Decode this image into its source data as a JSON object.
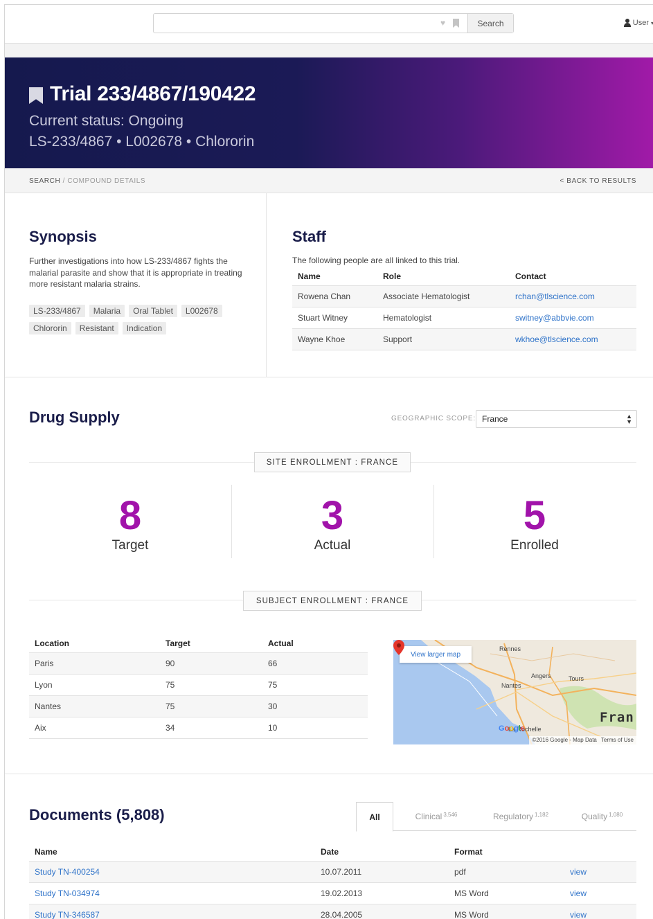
{
  "header": {
    "search": {
      "value": "",
      "placeholder": "",
      "button_label": "Search"
    },
    "user_label": "User"
  },
  "hero": {
    "title": "Trial 233/4867/190422",
    "status": "Current status: Ongoing",
    "ids": "LS-233/4867 • L002678 • Chlororin"
  },
  "breadcrumb": {
    "root": "SEARCH",
    "separator": " / ",
    "current": "COMPOUND DETAILS",
    "back": "< BACK TO RESULTS"
  },
  "synopsis": {
    "heading": "Synopsis",
    "text": "Further investigations into how LS-233/4867 fights the malarial parasite and show that it is appropriate in treating more resistant malaria strains.",
    "tags": [
      "LS-233/4867",
      "Malaria",
      "Oral Tablet",
      "L002678",
      "Chlororin",
      "Resistant",
      "Indication"
    ]
  },
  "staff": {
    "heading": "Staff",
    "intro": "The following people are all linked to this trial.",
    "columns": [
      "Name",
      "Role",
      "Contact"
    ],
    "rows": [
      [
        "Rowena Chan",
        "Associate Hematologist",
        "rchan@tlscience.com"
      ],
      [
        "Stuart Witney",
        "Hematologist",
        "switney@abbvie.com"
      ],
      [
        "Wayne Khoe",
        "Support",
        "wkhoe@tlscience.com"
      ]
    ]
  },
  "drug_supply": {
    "heading": "Drug Supply",
    "scope_label": "GEOGRAPHIC SCOPE:",
    "scope_value": "France",
    "site_enrollment_label": "SITE ENROLLMENT : FRANCE",
    "stats": [
      {
        "value": "8",
        "label": "Target"
      },
      {
        "value": "3",
        "label": "Actual"
      },
      {
        "value": "5",
        "label": "Enrolled"
      }
    ],
    "subject_enrollment_label": "SUBJECT ENROLLMENT : FRANCE",
    "table": {
      "columns": [
        "Location",
        "Target",
        "Actual"
      ],
      "rows": [
        [
          "Paris",
          "90",
          "66"
        ],
        [
          "Lyon",
          "75",
          "75"
        ],
        [
          "Nantes",
          "75",
          "30"
        ],
        [
          "Aix",
          "34",
          "10"
        ]
      ]
    },
    "map": {
      "button": "View larger map",
      "cities": [
        "Rennes",
        "Angers",
        "Tours",
        "Nantes",
        "La Rochelle"
      ],
      "country_label": "Fran",
      "attribution": "©2016 Google - Map Data",
      "terms": "Terms of Use",
      "logo": "Google",
      "colors": {
        "water": "#a9c8ef",
        "land": "#efe9de",
        "marker": "#e5352b"
      }
    }
  },
  "documents": {
    "heading": "Documents (5,808)",
    "tabs": [
      {
        "label": "All",
        "count": ""
      },
      {
        "label": "Clinical",
        "count": "3,546"
      },
      {
        "label": "Regulatory",
        "count": "1,182"
      },
      {
        "label": "Quality",
        "count": "1,080"
      }
    ],
    "columns": [
      "Name",
      "Date",
      "Format",
      ""
    ],
    "rows": [
      [
        "Study TN-400254",
        "10.07.2011",
        "pdf",
        "view"
      ],
      [
        "Study TN-034974",
        "19.02.2013",
        "MS Word",
        "view"
      ],
      [
        "Study TN-346587",
        "28.04.2005",
        "MS Word",
        "view"
      ]
    ]
  },
  "colors": {
    "accent": "#a113aa",
    "hero_start": "#15194e",
    "hero_end": "#a11aa8",
    "link": "#2f73c9",
    "heading": "#1a1d4a"
  }
}
